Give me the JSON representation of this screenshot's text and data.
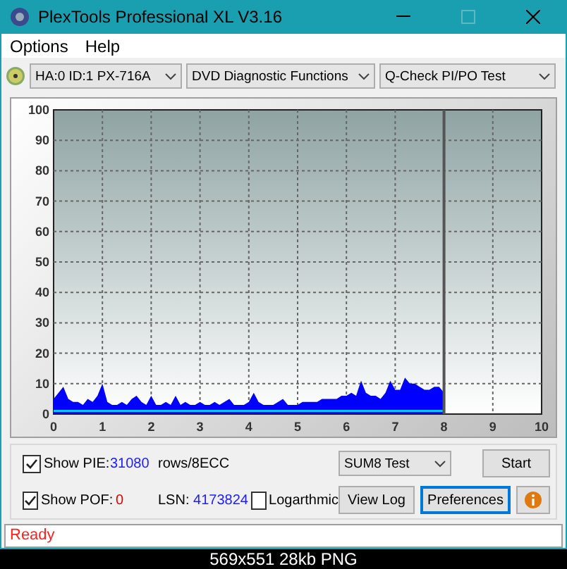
{
  "window": {
    "title": "PlexTools Professional XL V3.16"
  },
  "menu": [
    "Options",
    "Help"
  ],
  "toolbar": {
    "drive": "HA:0 ID:1  PX-716A",
    "mode": "DVD Diagnostic Functions",
    "test": "Q-Check PI/PO Test"
  },
  "chart": {
    "chart_data": {
      "type": "area",
      "xlim": [
        0,
        10
      ],
      "ylim": [
        0,
        100
      ],
      "xticks": [
        0,
        1,
        2,
        3,
        4,
        5,
        6,
        7,
        8,
        9,
        10
      ],
      "yticks": [
        0,
        10,
        20,
        30,
        40,
        50,
        60,
        70,
        80,
        90,
        100
      ],
      "x": [
        0,
        0.1,
        0.2,
        0.3,
        0.4,
        0.5,
        0.6,
        0.7,
        0.8,
        0.9,
        1,
        1.1,
        1.2,
        1.3,
        1.4,
        1.5,
        1.6,
        1.7,
        1.8,
        1.9,
        2,
        2.1,
        2.2,
        2.3,
        2.4,
        2.5,
        2.6,
        2.7,
        2.8,
        2.9,
        3,
        3.1,
        3.2,
        3.3,
        3.4,
        3.5,
        3.6,
        3.7,
        3.8,
        3.9,
        4,
        4.1,
        4.2,
        4.3,
        4.4,
        4.5,
        4.6,
        4.7,
        4.8,
        4.9,
        5,
        5.1,
        5.2,
        5.3,
        5.4,
        5.5,
        5.6,
        5.7,
        5.8,
        5.9,
        6,
        6.1,
        6.2,
        6.3,
        6.4,
        6.5,
        6.6,
        6.7,
        6.8,
        6.9,
        7,
        7.1,
        7.2,
        7.3,
        7.4,
        7.5,
        7.6,
        7.7,
        7.8,
        7.9,
        8
      ],
      "series": [
        {
          "color": "#0000ff",
          "values": [
            5,
            7,
            9,
            5,
            4,
            4,
            3,
            5,
            4,
            6,
            10,
            4,
            3,
            3,
            4,
            3,
            5,
            6,
            4,
            3,
            6,
            3,
            3,
            4,
            3,
            6,
            3,
            4,
            3,
            3,
            4,
            3,
            3,
            4,
            3,
            4,
            5,
            3,
            3,
            3,
            4,
            7,
            4,
            3,
            3,
            3,
            4,
            5,
            3,
            3,
            3,
            4,
            4,
            4,
            4,
            5,
            5,
            5,
            5,
            6,
            6,
            7,
            6,
            11,
            7,
            6,
            6,
            5,
            7,
            11,
            8,
            8,
            12,
            10,
            10,
            9,
            8,
            8,
            9,
            9,
            7
          ]
        },
        {
          "color": "#00c8ff",
          "type": "line",
          "values": [
            1,
            1,
            1,
            1,
            1,
            1,
            1,
            1,
            1,
            1,
            1,
            1,
            1,
            1,
            1,
            1,
            1,
            1,
            1,
            1,
            1,
            1,
            1,
            1,
            1,
            1,
            1,
            1,
            1,
            1,
            1,
            1,
            1,
            1,
            1,
            1,
            1,
            1,
            1,
            1,
            1,
            1,
            1,
            1,
            1,
            1,
            1,
            1,
            1,
            1,
            1,
            1,
            1,
            1,
            1,
            1,
            1,
            1,
            1,
            1,
            1,
            1,
            1,
            1,
            1,
            1,
            1,
            1,
            1,
            1,
            1,
            1,
            1,
            1,
            1,
            1,
            1,
            1,
            1,
            1,
            1
          ]
        }
      ],
      "grid": true,
      "ref_lines": [
        {
          "axis": "x",
          "value": 8,
          "color": "#555555"
        }
      ]
    }
  },
  "controls": {
    "pie": {
      "label": "Show PIE:",
      "checked": true,
      "value": "31080",
      "unit": "rows/8ECC"
    },
    "pof": {
      "label": "Show POF:",
      "checked": true,
      "value": "0"
    },
    "lsn": {
      "label": "LSN:",
      "value": "4173824"
    },
    "logarithmic": {
      "label": "Logarthmic",
      "checked": false
    },
    "sum_test": "SUM8 Test",
    "buttons": [
      {
        "label": "Start",
        "focused": false
      },
      {
        "label": "View Log",
        "focused": false
      },
      {
        "label": "Preferences",
        "focused": true
      }
    ]
  },
  "status_bar": "Ready",
  "caption": "569x551 28kb PNG"
}
